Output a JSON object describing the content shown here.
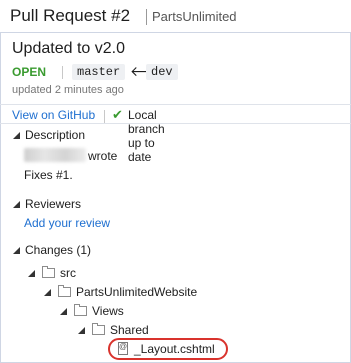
{
  "header": {
    "title": "Pull Request #2",
    "repo": "PartsUnlimited"
  },
  "pr": {
    "title": "Updated to v2.0",
    "status": "OPEN",
    "target_branch": "master",
    "source_branch": "dev",
    "updated": "updated 2 minutes ago"
  },
  "actions": {
    "view_on_github": "View on GitHub",
    "local_status": "Local branch up to date"
  },
  "description": {
    "heading": "Description",
    "wrote": "wrote",
    "body": "Fixes #1."
  },
  "reviewers": {
    "heading": "Reviewers",
    "add_review": "Add your review"
  },
  "changes": {
    "heading": "Changes (1)",
    "tree": [
      {
        "label": "src",
        "type": "folder"
      },
      {
        "label": "PartsUnlimitedWebsite",
        "type": "folder"
      },
      {
        "label": "Views",
        "type": "folder"
      },
      {
        "label": "Shared",
        "type": "folder"
      },
      {
        "label": "_Layout.cshtml",
        "type": "file"
      }
    ]
  },
  "colors": {
    "open": "#3a9b30",
    "link": "#1e6fd0",
    "highlight": "#d9332d"
  },
  "icons": [
    "arrow-left-icon",
    "check-icon",
    "expand-triangle-icon",
    "folder-icon",
    "file-icon"
  ]
}
